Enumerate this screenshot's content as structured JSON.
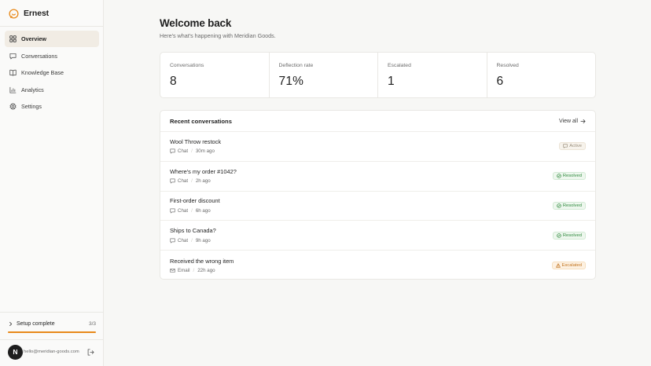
{
  "app": {
    "name": "Ernest",
    "brand_color": "#e8891a"
  },
  "nav": [
    {
      "label": "Overview",
      "icon": "grid-icon",
      "active": true
    },
    {
      "label": "Conversations",
      "icon": "chat-icon",
      "active": false
    },
    {
      "label": "Knowledge Base",
      "icon": "book-icon",
      "active": false
    },
    {
      "label": "Analytics",
      "icon": "bar-chart-icon",
      "active": false
    },
    {
      "label": "Settings",
      "icon": "gear-icon",
      "active": false
    }
  ],
  "setup": {
    "label": "Setup complete",
    "count": "3/3",
    "progress": 1.0
  },
  "user": {
    "initial": "N",
    "email": "hello@meridian-goods.com"
  },
  "header": {
    "title": "Welcome back",
    "subtitle": "Here's what's happening with Meridian Goods."
  },
  "stats": [
    {
      "label": "Conversations",
      "value": "8"
    },
    {
      "label": "Deflection rate",
      "value": "71%"
    },
    {
      "label": "Escalated",
      "value": "1"
    },
    {
      "label": "Resolved",
      "value": "6"
    }
  ],
  "recent": {
    "title": "Recent conversations",
    "view_all": "View all",
    "rows": [
      {
        "title": "Wool Throw restock",
        "channel": "Chat",
        "channel_icon": "chat-icon",
        "time": "30m ago",
        "status": "Active",
        "status_kind": "active"
      },
      {
        "title": "Where's my order #1042?",
        "channel": "Chat",
        "channel_icon": "chat-icon",
        "time": "2h ago",
        "status": "Resolved",
        "status_kind": "resolved"
      },
      {
        "title": "First-order discount",
        "channel": "Chat",
        "channel_icon": "chat-icon",
        "time": "6h ago",
        "status": "Resolved",
        "status_kind": "resolved"
      },
      {
        "title": "Ships to Canada?",
        "channel": "Chat",
        "channel_icon": "chat-icon",
        "time": "9h ago",
        "status": "Resolved",
        "status_kind": "resolved"
      },
      {
        "title": "Received the wrong item",
        "channel": "Email",
        "channel_icon": "mail-icon",
        "time": "22h ago",
        "status": "Escalated",
        "status_kind": "escalated"
      }
    ]
  }
}
